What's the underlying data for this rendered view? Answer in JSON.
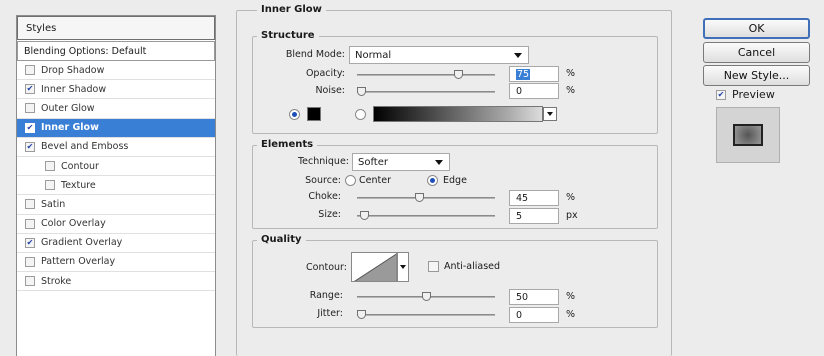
{
  "sidebar": {
    "header": "Styles",
    "blending_options": "Blending Options: Default",
    "items": [
      {
        "label": "Drop Shadow",
        "checked": false,
        "sub": false,
        "selected": false
      },
      {
        "label": "Inner Shadow",
        "checked": true,
        "sub": false,
        "selected": false
      },
      {
        "label": "Outer Glow",
        "checked": false,
        "sub": false,
        "selected": false
      },
      {
        "label": "Inner Glow",
        "checked": true,
        "sub": false,
        "selected": true
      },
      {
        "label": "Bevel and Emboss",
        "checked": true,
        "sub": false,
        "selected": false
      },
      {
        "label": "Contour",
        "checked": false,
        "sub": true,
        "selected": false
      },
      {
        "label": "Texture",
        "checked": false,
        "sub": true,
        "selected": false
      },
      {
        "label": "Satin",
        "checked": false,
        "sub": false,
        "selected": false
      },
      {
        "label": "Color Overlay",
        "checked": false,
        "sub": false,
        "selected": false
      },
      {
        "label": "Gradient Overlay",
        "checked": true,
        "sub": false,
        "selected": false
      },
      {
        "label": "Pattern Overlay",
        "checked": false,
        "sub": false,
        "selected": false
      },
      {
        "label": "Stroke",
        "checked": false,
        "sub": false,
        "selected": false
      }
    ]
  },
  "panel": {
    "title": "Inner Glow",
    "structure": {
      "title": "Structure",
      "blend_mode_label": "Blend Mode:",
      "blend_mode_value": "Normal",
      "opacity_label": "Opacity:",
      "opacity_value": "75",
      "opacity_unit": "%",
      "opacity_fraction": 0.75,
      "noise_label": "Noise:",
      "noise_value": "0",
      "noise_unit": "%",
      "noise_fraction": 0.0,
      "fill_mode": "color",
      "glow_color": "#000000"
    },
    "elements": {
      "title": "Elements",
      "technique_label": "Technique:",
      "technique_value": "Softer",
      "source_label": "Source:",
      "source_center": "Center",
      "source_edge": "Edge",
      "source_selected": "edge",
      "choke_label": "Choke:",
      "choke_value": "45",
      "choke_unit": "%",
      "choke_fraction": 0.45,
      "size_label": "Size:",
      "size_value": "5",
      "size_unit": "px",
      "size_fraction": 0.02
    },
    "quality": {
      "title": "Quality",
      "contour_label": "Contour:",
      "anti_aliased_label": "Anti-aliased",
      "anti_aliased": false,
      "range_label": "Range:",
      "range_value": "50",
      "range_unit": "%",
      "range_fraction": 0.5,
      "jitter_label": "Jitter:",
      "jitter_value": "0",
      "jitter_unit": "%",
      "jitter_fraction": 0.0
    }
  },
  "buttons": {
    "ok": "OK",
    "cancel": "Cancel",
    "new_style": "New Style...",
    "preview_label": "Preview",
    "preview_checked": true
  },
  "colors": {
    "selection": "#3a7fd6",
    "checkmark": "#1f3fa8"
  }
}
